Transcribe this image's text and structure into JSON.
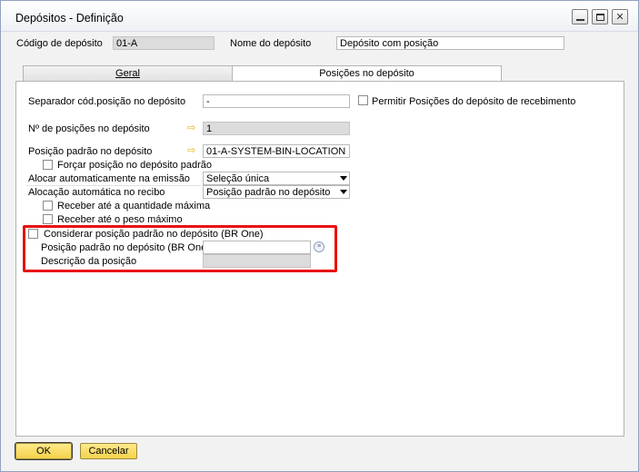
{
  "window": {
    "title": "Depósitos - Definição",
    "controls": {
      "minimize": "minimize-icon",
      "maximize": "maximize-icon",
      "close": "close-icon"
    }
  },
  "header": {
    "code_label": "Código de depósito",
    "code_value": "01-A",
    "name_label": "Nome do depósito",
    "name_value": "Depósito com posição"
  },
  "tabs": [
    {
      "label": "Geral",
      "active": false
    },
    {
      "label": "Posições no depósito",
      "active": true
    }
  ],
  "form": {
    "separator_label": "Separador cód.posição no depósito",
    "separator_value": "-",
    "permit_label": "Permitir Posições do depósito de recebimento",
    "num_positions_label": "Nº de posições no depósito",
    "num_positions_value": "1",
    "default_position_label": "Posição padrão no depósito",
    "default_position_value": "01-A-SYSTEM-BIN-LOCATION",
    "force_default_label": "Forçar posição no depósito padrão",
    "auto_alloc_issue_label": "Alocar automaticamente na emissão",
    "auto_alloc_issue_value": "Seleção única",
    "auto_alloc_receipt_label": "Alocação automática no recibo",
    "auto_alloc_receipt_value": "Posição padrão no depósito",
    "receive_max_qty_label": "Receber até a quantidade máxima",
    "receive_max_weight_label": "Receber até o peso máximo"
  },
  "br_one": {
    "consider_label": "Considerar posição padrão no depósito (BR One)",
    "default_position_label": "Posição padrão no depósito (BR One)",
    "default_position_value": "",
    "description_label": "Descrição da posição",
    "description_value": "",
    "highlight_color": "#e8100d"
  },
  "footer": {
    "ok_label": "OK",
    "cancel_label": "Cancelar"
  },
  "colors": {
    "button_yellow": "#f3d24c",
    "link_arrow": "#e7b400"
  }
}
